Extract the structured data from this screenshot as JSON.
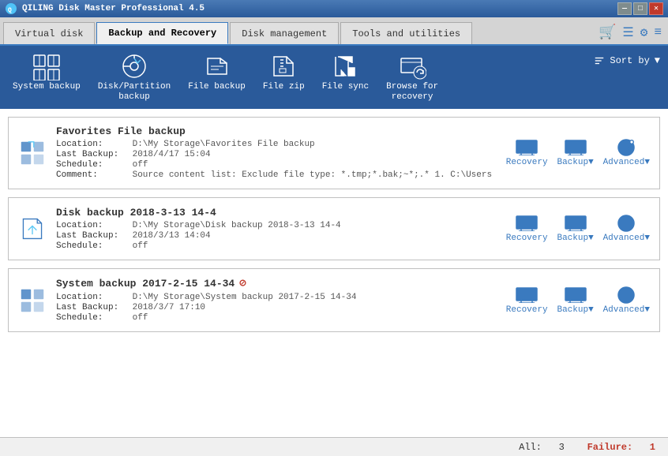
{
  "titlebar": {
    "title": "QILING Disk Master Professional 4.5",
    "minimize": "—",
    "maximize": "□",
    "close": "✕"
  },
  "tabs": [
    {
      "label": "Virtual disk",
      "active": false
    },
    {
      "label": "Backup and Recovery",
      "active": true
    },
    {
      "label": "Disk management",
      "active": false
    },
    {
      "label": "Tools and utilities",
      "active": false
    }
  ],
  "toolbar": {
    "items": [
      {
        "label": "System backup",
        "icon": "grid-icon"
      },
      {
        "label": "Disk/Partition\nbackup",
        "icon": "partition-icon"
      },
      {
        "label": "File backup",
        "icon": "folder-icon"
      },
      {
        "label": "File zip",
        "icon": "zip-icon"
      },
      {
        "label": "File sync",
        "icon": "sync-icon"
      },
      {
        "label": "Browse for\nrecovery",
        "icon": "browse-icon"
      }
    ],
    "sort_label": "Sort by"
  },
  "backup_items": [
    {
      "title": "Favorites File backup",
      "icon_type": "file",
      "location": "D:\\My Storage\\Favorites File backup",
      "last_backup": "2018/4/17 15:04",
      "schedule": "off",
      "comment": "Source content list:  Exclude file type: *.tmp;*.bak;~*;.*  1. C:\\Users",
      "has_warning": false,
      "actions": [
        "Recovery",
        "Backup▼",
        "Advanced▼"
      ]
    },
    {
      "title": "Disk backup 2018-3-13 14-4",
      "icon_type": "disk",
      "location": "D:\\My Storage\\Disk backup 2018-3-13 14-4",
      "last_backup": "2018/3/13 14:04",
      "schedule": "off",
      "comment": "",
      "has_warning": false,
      "actions": [
        "Recovery",
        "Backup▼",
        "Advanced▼"
      ]
    },
    {
      "title": "System backup 2017-2-15 14-34",
      "icon_type": "system",
      "location": "D:\\My Storage\\System backup 2017-2-15 14-34",
      "last_backup": "2018/3/7 17:10",
      "schedule": "off",
      "comment": "",
      "has_warning": true,
      "actions": [
        "Recovery",
        "Backup▼",
        "Advanced▼"
      ]
    }
  ],
  "labels": {
    "location": "Location:",
    "last_backup": "Last Backup:",
    "schedule": "Schedule:",
    "comment": "Comment:"
  },
  "status": {
    "all_label": "All:",
    "all_count": "3",
    "failure_label": "Failure:",
    "failure_count": "1"
  }
}
